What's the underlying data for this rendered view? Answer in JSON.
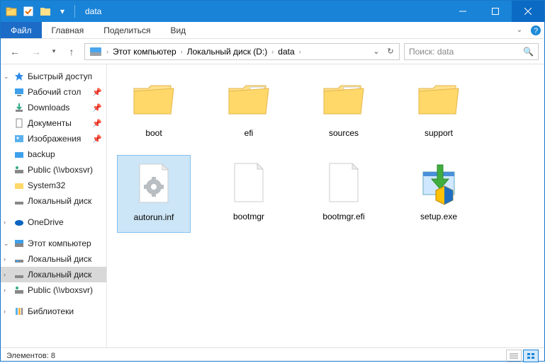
{
  "titlebar": {
    "title": "data"
  },
  "menubar": {
    "file": "Файл",
    "tabs": [
      "Главная",
      "Поделиться",
      "Вид"
    ]
  },
  "breadcrumb": {
    "items": [
      "Этот компьютер",
      "Локальный диск (D:)",
      "data"
    ]
  },
  "search": {
    "placeholder": "Поиск: data"
  },
  "sidebar": {
    "quick_access": "Быстрый доступ",
    "items_pinned": [
      "Рабочий стол",
      "Downloads",
      "Документы",
      "Изображения",
      "backup",
      "Public (\\\\vboxsvr)",
      "System32",
      "Локальный диск"
    ],
    "onedrive": "OneDrive",
    "this_pc": "Этот компьютер",
    "drives": [
      "Локальный диск",
      "Локальный диск",
      "Public (\\\\vboxsvr)"
    ],
    "libraries": "Библиотеки"
  },
  "files": [
    {
      "name": "boot",
      "type": "folder"
    },
    {
      "name": "efi",
      "type": "folder"
    },
    {
      "name": "sources",
      "type": "folder"
    },
    {
      "name": "support",
      "type": "folder"
    },
    {
      "name": "autorun.inf",
      "type": "inf",
      "selected": true
    },
    {
      "name": "bootmgr",
      "type": "file"
    },
    {
      "name": "bootmgr.efi",
      "type": "file"
    },
    {
      "name": "setup.exe",
      "type": "exe"
    }
  ],
  "statusbar": {
    "count_label": "Элементов: 8"
  }
}
